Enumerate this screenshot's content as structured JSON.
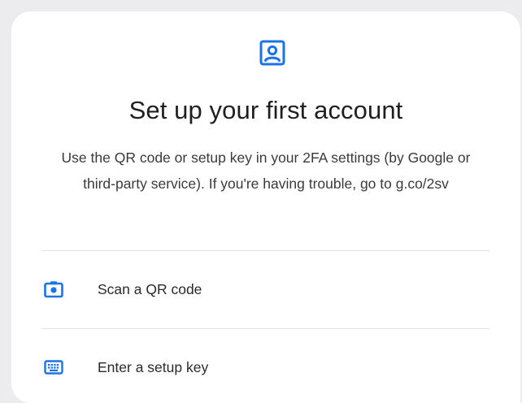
{
  "header": {
    "icon": "account-box-icon",
    "title": "Set up your first account",
    "description": "Use the QR code or setup key in your 2FA settings (by Google or third-party service). If you're having trouble, go to g.co/2sv"
  },
  "options": [
    {
      "icon": "camera-icon",
      "label": "Scan a QR code"
    },
    {
      "icon": "keyboard-icon",
      "label": "Enter a setup key"
    }
  ],
  "colors": {
    "accent": "#1a73e8",
    "background": "#ececef",
    "card": "#ffffff"
  }
}
